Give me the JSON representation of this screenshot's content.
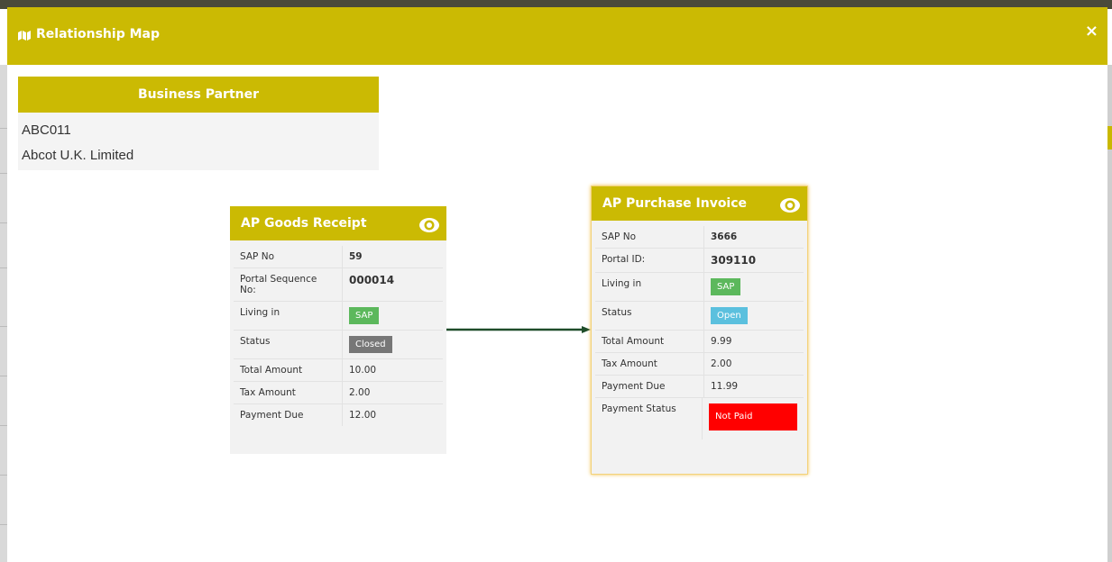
{
  "modal": {
    "title": "Relationship Map",
    "close_icon": "×"
  },
  "business_partner": {
    "header": "Business Partner",
    "code": "ABC011",
    "name": "Abcot U.K. Limited"
  },
  "goods_receipt": {
    "title": "AP Goods Receipt",
    "rows": [
      {
        "label": "SAP No",
        "value": "59"
      },
      {
        "label": "Portal Sequence No:",
        "value": "000014"
      },
      {
        "label": "Living in",
        "value": "SAP"
      },
      {
        "label": "Status",
        "value": "Closed"
      },
      {
        "label": "Total Amount",
        "value": "10.00"
      },
      {
        "label": "Tax Amount",
        "value": "2.00"
      },
      {
        "label": "Payment Due",
        "value": "12.00"
      }
    ]
  },
  "purchase_invoice": {
    "title": "AP Purchase Invoice",
    "rows": [
      {
        "label": "SAP No",
        "value": "3666"
      },
      {
        "label": "Portal ID:",
        "value": "309110"
      },
      {
        "label": "Living in",
        "value": "SAP"
      },
      {
        "label": "Status",
        "value": "Open"
      },
      {
        "label": "Total Amount",
        "value": "9.99"
      },
      {
        "label": "Tax Amount",
        "value": "2.00"
      },
      {
        "label": "Payment Due",
        "value": "11.99"
      },
      {
        "label": "Payment Status",
        "value": "Not Paid"
      }
    ]
  },
  "colors": {
    "accent": "#cbba03",
    "sap_badge": "#5cb85c",
    "closed_badge": "#777777",
    "open_badge": "#5bc0de",
    "not_paid_badge": "#ff0000",
    "connector": "#1f4d2a"
  }
}
